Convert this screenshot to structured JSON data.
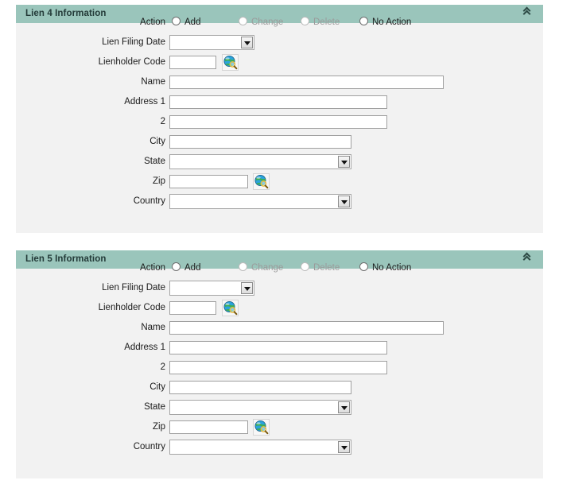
{
  "theme": {
    "header_bg": "#9ac5bb",
    "header_text": "#233a38",
    "panel_bg": "#f2f2f2",
    "page_bg": "#ffffff",
    "field_border": "#a0a0a0",
    "disabled_text": "#9b9b9b"
  },
  "panels": [
    {
      "title": "Lien 4 Information",
      "collapse_icon": "double-chevron-up-icon",
      "action": {
        "label": "Action",
        "options": [
          {
            "label": "Add",
            "selected": false,
            "disabled": false
          },
          {
            "label": "Change",
            "selected": false,
            "disabled": true
          },
          {
            "label": "Delete",
            "selected": false,
            "disabled": true
          },
          {
            "label": "No Action",
            "selected": false,
            "disabled": false
          }
        ]
      },
      "fields": {
        "lien_filing_date": {
          "label": "Lien Filing Date",
          "value": "",
          "type": "select"
        },
        "lienholder_code": {
          "label": "Lienholder Code",
          "value": "",
          "type": "text",
          "lookup_icon": "globe-search-icon"
        },
        "name": {
          "label": "Name",
          "value": "",
          "type": "text"
        },
        "address1": {
          "label": "Address 1",
          "value": "",
          "type": "text"
        },
        "address2": {
          "label": "2",
          "value": "",
          "type": "text"
        },
        "city": {
          "label": "City",
          "value": "",
          "type": "text"
        },
        "state": {
          "label": "State",
          "value": "",
          "type": "select"
        },
        "zip": {
          "label": "Zip",
          "value": "",
          "type": "text",
          "lookup_icon": "globe-search-icon"
        },
        "country": {
          "label": "Country",
          "value": "",
          "type": "select"
        }
      }
    },
    {
      "title": "Lien 5 Information",
      "collapse_icon": "double-chevron-up-icon",
      "action": {
        "label": "Action",
        "options": [
          {
            "label": "Add",
            "selected": false,
            "disabled": false
          },
          {
            "label": "Change",
            "selected": false,
            "disabled": true
          },
          {
            "label": "Delete",
            "selected": false,
            "disabled": true
          },
          {
            "label": "No Action",
            "selected": false,
            "disabled": false
          }
        ]
      },
      "fields": {
        "lien_filing_date": {
          "label": "Lien Filing Date",
          "value": "",
          "type": "select"
        },
        "lienholder_code": {
          "label": "Lienholder Code",
          "value": "",
          "type": "text",
          "lookup_icon": "globe-search-icon"
        },
        "name": {
          "label": "Name",
          "value": "",
          "type": "text"
        },
        "address1": {
          "label": "Address 1",
          "value": "",
          "type": "text"
        },
        "address2": {
          "label": "2",
          "value": "",
          "type": "text"
        },
        "city": {
          "label": "City",
          "value": "",
          "type": "text"
        },
        "state": {
          "label": "State",
          "value": "",
          "type": "select"
        },
        "zip": {
          "label": "Zip",
          "value": "",
          "type": "text",
          "lookup_icon": "globe-search-icon"
        },
        "country": {
          "label": "Country",
          "value": "",
          "type": "select"
        }
      }
    }
  ]
}
